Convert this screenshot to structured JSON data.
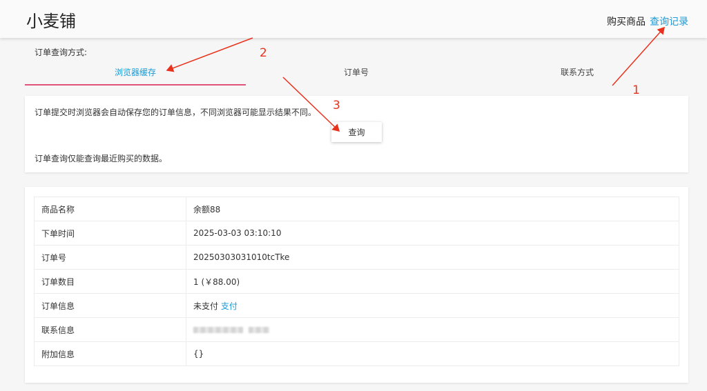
{
  "header": {
    "brand": "小麦铺",
    "nav_buy": "购买商品",
    "nav_query": "查询记录"
  },
  "query": {
    "label": "订单查询方式:",
    "tabs": [
      {
        "label": "浏览器缓存",
        "active": true
      },
      {
        "label": "订单号",
        "active": false
      },
      {
        "label": "联系方式",
        "active": false
      }
    ],
    "note1": "订单提交时浏览器会自动保存您的订单信息，不同浏览器可能显示结果不同。",
    "button": "查询",
    "note2": "订单查询仅能查询最近购买的数据。"
  },
  "order": {
    "rows": [
      {
        "key": "商品名称",
        "value": "余额88"
      },
      {
        "key": "下单时间",
        "value": "2025-03-03 03:10:10"
      },
      {
        "key": "订单号",
        "value": "20250303031010tcTke"
      },
      {
        "key": "订单数目",
        "value": "1 (￥88.00)"
      },
      {
        "key": "订单信息",
        "value": "未支付",
        "link": "支付"
      },
      {
        "key": "联系信息",
        "value": ""
      },
      {
        "key": "附加信息",
        "value": "{}"
      }
    ]
  },
  "annotations": {
    "numbers": [
      "1",
      "2",
      "3"
    ],
    "color": "#e8321e"
  },
  "colors": {
    "accent": "#1a9bd7",
    "tab_underline": "#e1527a"
  }
}
